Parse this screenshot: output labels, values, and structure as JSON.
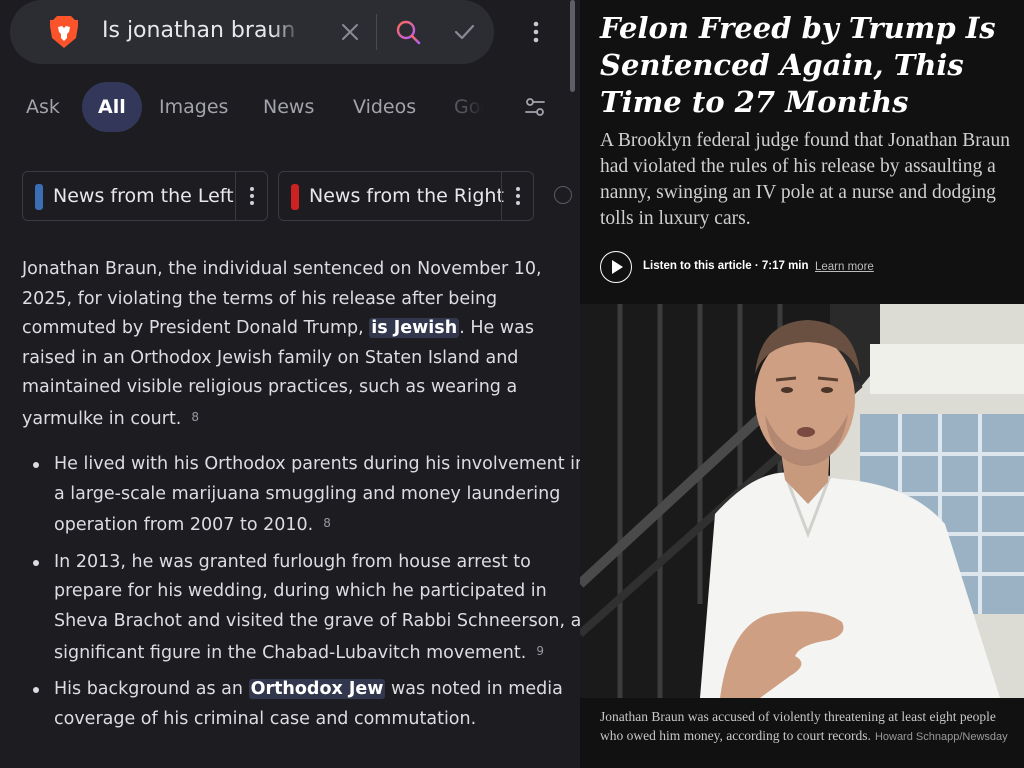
{
  "search": {
    "query": "Is jonathan braun jewish"
  },
  "tabs": [
    "Ask",
    "All",
    "Images",
    "News",
    "Videos",
    "Goggles"
  ],
  "active_tab": "All",
  "chips": {
    "left": "News from the Left",
    "right": "News from the Right"
  },
  "answer": {
    "p1": "Jonathan Braun, the individual sentenced on November 10, 2025, for violating the terms of his release after being commuted by President Donald Trump, ",
    "p1_highlight": "is Jewish",
    "p1_end": ". He was raised in an Orthodox Jewish family on Staten Island and maintained visible religious practices, such as wearing a yarmulke in court.",
    "p1_cite": "8",
    "bullet1": "He lived with his Orthodox parents during his involvement in a large-scale marijuana smuggling and money laundering operation from 2007 to 2010.",
    "bullet1_cite": "8",
    "bullet2": "In 2013, he was granted furlough from house arrest to prepare for his wedding, during which he participated in Sheva Brachot and visited the grave of Rabbi Schneerson, a significant figure in the Chabad-Lubavitch movement.",
    "bullet2_cite": "9",
    "bullet3_start": "His background as an ",
    "bullet3_highlight": "Orthodox Jew",
    "bullet3_end": " was noted in media coverage of his criminal case and commutation."
  },
  "article": {
    "headline": "Felon Freed by Trump Is Sentenced Again, This Time to 27 Months",
    "summary": "A Brooklyn federal judge found that Jonathan Braun had violated the rules of his release by assaulting a nanny, swinging an IV pole at a nurse and dodging tolls in luxury cars.",
    "listen": "Listen to this article · 7:17 min",
    "learn_more": "Learn more",
    "caption": "Jonathan Braun was accused of violently threatening at least eight people who owed him money, according to court records.",
    "credit": "Howard Schnapp/Newsday"
  },
  "colors": {
    "left_bg": "#1c1c21",
    "active_tab_bg": "#33385a",
    "left_chip": "#3a6fb5",
    "right_chip": "#cc2222",
    "highlight_bg": "#33374e",
    "article_bg": "#111111"
  }
}
